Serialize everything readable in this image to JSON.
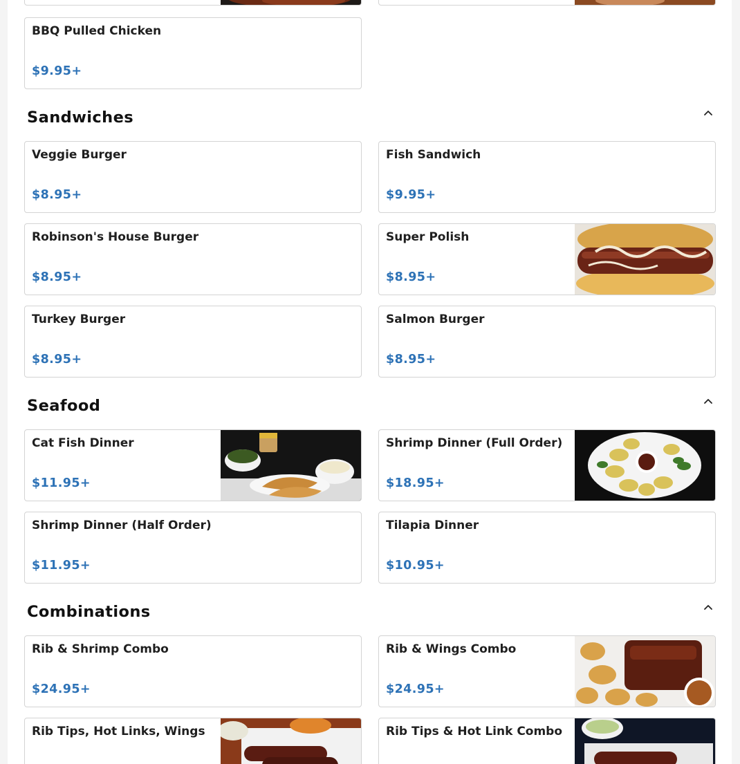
{
  "theme": {
    "price_color": "#2d72b6",
    "border_color": "#d3d3d3"
  },
  "top_partial": {
    "left_image": "ribs-photo",
    "right_image": "meat-photo"
  },
  "bbq": {
    "items": [
      {
        "name": "BBQ Pulled Chicken",
        "price": "$9.95+"
      }
    ]
  },
  "sandwiches": {
    "title": "Sandwiches",
    "collapse_icon": "chevron-up-icon",
    "items": [
      {
        "name": "Veggie Burger",
        "price": "$8.95+"
      },
      {
        "name": "Fish Sandwich",
        "price": "$9.95+"
      },
      {
        "name": "Robinson's House Burger",
        "price": "$8.95+"
      },
      {
        "name": "Super Polish",
        "price": "$8.95+",
        "image": "polish-sausage-photo"
      },
      {
        "name": "Turkey Burger",
        "price": "$8.95+"
      },
      {
        "name": "Salmon Burger",
        "price": "$8.95+"
      }
    ]
  },
  "seafood": {
    "title": "Seafood",
    "collapse_icon": "chevron-up-icon",
    "items": [
      {
        "name": "Cat Fish Dinner",
        "price": "$11.95+",
        "image": "catfish-dinner-photo"
      },
      {
        "name": "Shrimp Dinner (Full Order)",
        "price": "$18.95+",
        "image": "shrimp-platter-photo"
      },
      {
        "name": "Shrimp Dinner (Half Order)",
        "price": "$11.95+"
      },
      {
        "name": "Tilapia Dinner",
        "price": "$10.95+"
      }
    ]
  },
  "combinations": {
    "title": "Combinations",
    "collapse_icon": "chevron-up-icon",
    "items": [
      {
        "name": "Rib & Shrimp Combo",
        "price": "$24.95+"
      },
      {
        "name": "Rib & Wings Combo",
        "price": "$24.95+",
        "image": "rib-wings-photo"
      },
      {
        "name": "Rib Tips, Hot Links, Wings",
        "image": "rib-tips-links-wings-photo"
      },
      {
        "name": "Rib Tips & Hot Link Combo",
        "image": "rib-tips-hot-link-photo"
      }
    ]
  }
}
